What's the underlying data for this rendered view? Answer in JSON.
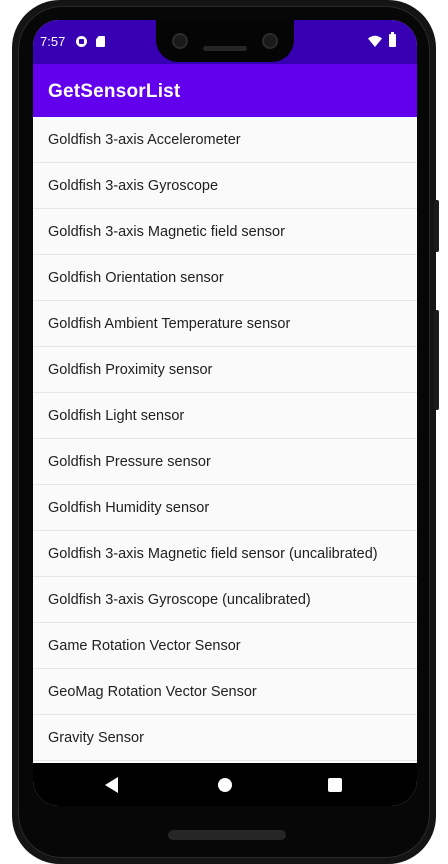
{
  "status_bar": {
    "time": "7:57",
    "icons": [
      "notification-icon",
      "sim-card-icon",
      "wifi-icon",
      "battery-icon"
    ]
  },
  "app_bar": {
    "title": "GetSensorList",
    "color": "#6200ee",
    "status_color": "#3700b3"
  },
  "sensors": [
    "Goldfish 3-axis Accelerometer",
    "Goldfish 3-axis Gyroscope",
    "Goldfish 3-axis Magnetic field sensor",
    "Goldfish Orientation sensor",
    "Goldfish Ambient Temperature sensor",
    "Goldfish Proximity sensor",
    "Goldfish Light sensor",
    "Goldfish Pressure sensor",
    "Goldfish Humidity sensor",
    "Goldfish 3-axis Magnetic field sensor (uncalibrated)",
    "Goldfish 3-axis Gyroscope (uncalibrated)",
    "Game Rotation Vector Sensor",
    "GeoMag Rotation Vector Sensor",
    "Gravity Sensor"
  ],
  "nav_bar": {
    "buttons": [
      "back-icon",
      "home-icon",
      "recents-icon"
    ]
  }
}
